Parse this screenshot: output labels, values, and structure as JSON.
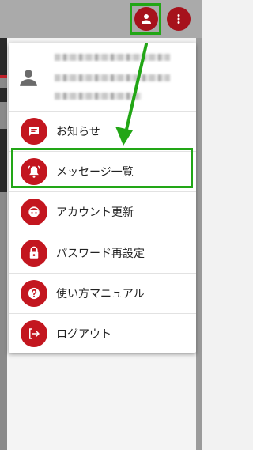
{
  "menu": {
    "items": [
      {
        "label": "お知らせ",
        "icon": "chat-message-icon"
      },
      {
        "label": "メッセージ一覧",
        "icon": "bell-alert-icon"
      },
      {
        "label": "アカウント更新",
        "icon": "face-icon"
      },
      {
        "label": "パスワード再設定",
        "icon": "lock-icon"
      },
      {
        "label": "使い方マニュアル",
        "icon": "help-icon"
      },
      {
        "label": "ログアウト",
        "icon": "logout-icon"
      }
    ]
  },
  "colors": {
    "brand_red": "#c3161f",
    "highlight_green": "#22a616"
  }
}
